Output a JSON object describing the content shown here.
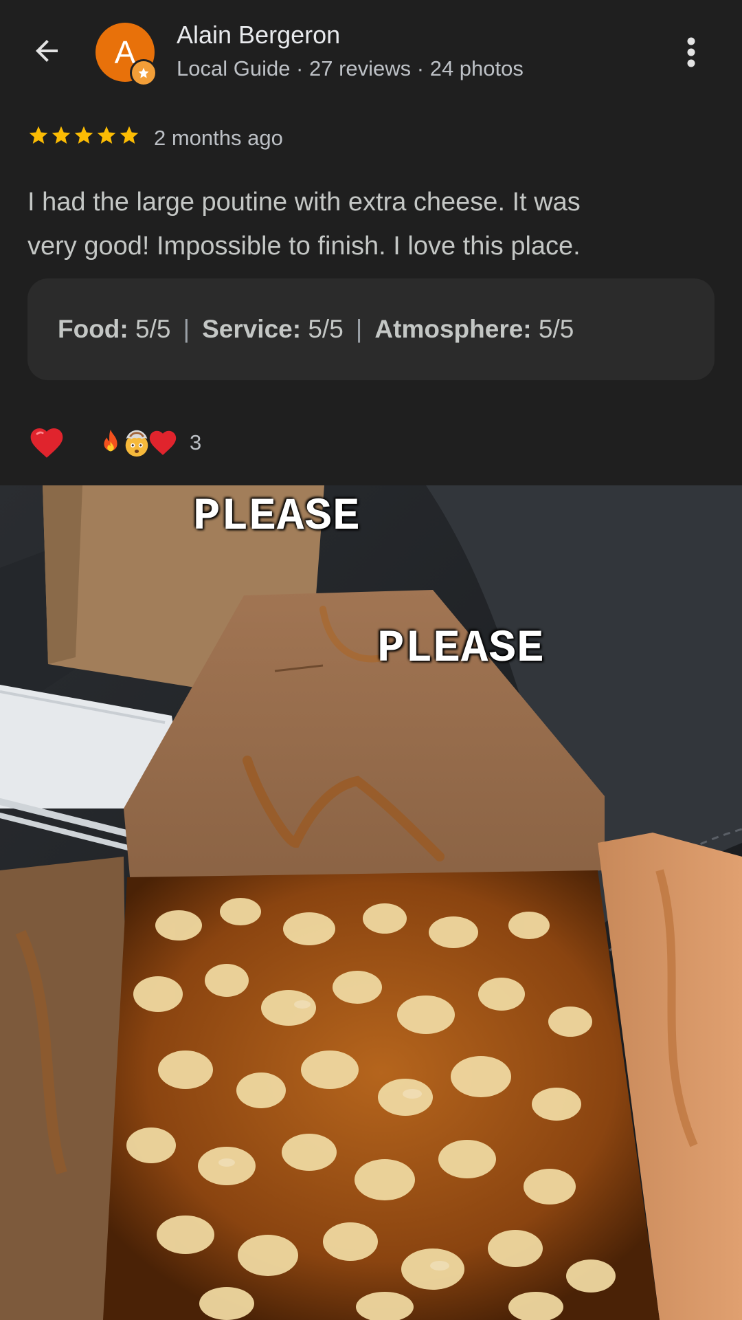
{
  "header": {
    "back_icon": "arrow-back-icon",
    "avatar_letter": "A",
    "reviewer_name": "Alain Bergeron",
    "reviewer_meta": "Local Guide · 27 reviews · 24 photos",
    "more_icon": "more-vert-icon"
  },
  "review": {
    "rating": 5,
    "max_rating": 5,
    "date": "2 months ago",
    "text_lines": [
      "I had the large poutine with extra cheese. It was",
      "very good! Impossible to finish. I love this place."
    ],
    "sub_ratings": [
      {
        "label": "Food:",
        "value": "5/5"
      },
      {
        "label": "Service:",
        "value": "5/5"
      },
      {
        "label": "Atmosphere:",
        "value": "5/5"
      }
    ]
  },
  "reactions": {
    "like_icon": "red-heart-icon",
    "icons": [
      "fire-emoji-icon",
      "exploding-head-emoji-icon",
      "red-heart-emoji-icon"
    ],
    "count": "3"
  },
  "photo": {
    "overlay_lines": [
      "PLEASE",
      "PLEASE"
    ]
  },
  "colors": {
    "background": "#1f1f1f",
    "avatar": "#e8710a",
    "star": "#fbbc04",
    "pill": "#2b2b2b",
    "heart": "#e0242d"
  }
}
